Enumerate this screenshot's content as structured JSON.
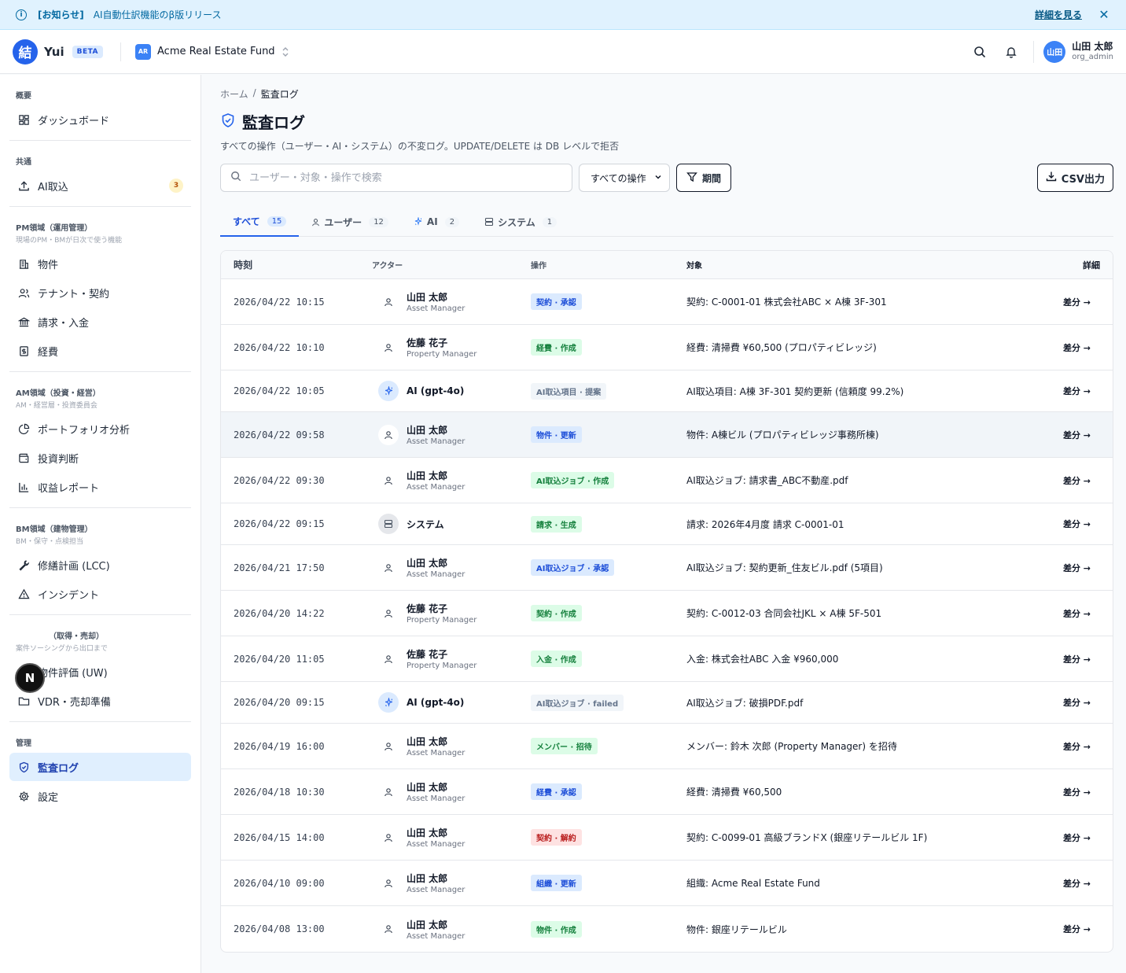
{
  "announcement": {
    "tag": "[お知らせ]",
    "text": "AI自動仕訳機能のβ版リリース",
    "link": "詳細を見る",
    "close": "✕"
  },
  "header": {
    "logo_char": "結",
    "brand": "Yui",
    "beta": "BETA",
    "org_badge": "AR",
    "org_name": "Acme Real Estate Fund",
    "user_avatar": "山田",
    "user_name": "山田 太郎",
    "user_role": "org_admin"
  },
  "sidebar": {
    "sections": [
      {
        "title": "概要",
        "items": [
          {
            "label": "ダッシュボード",
            "icon": "dashboard-icon"
          }
        ]
      },
      {
        "title": "共通",
        "items": [
          {
            "label": "AI取込",
            "icon": "upload-icon",
            "count": "3"
          }
        ]
      },
      {
        "title": "PM領域（運用管理）",
        "sub": "現場のPM・BMが日次で使う機能",
        "items": [
          {
            "label": "物件",
            "icon": "building-icon"
          },
          {
            "label": "テナント・契約",
            "icon": "users-icon"
          },
          {
            "label": "請求・入金",
            "icon": "bank-icon"
          },
          {
            "label": "経費",
            "icon": "receipt-icon"
          }
        ]
      },
      {
        "title": "AM領域（投資・経営）",
        "sub": "AM・経営層・投資委員会",
        "items": [
          {
            "label": "ポートフォリオ分析",
            "icon": "pie-chart-icon"
          },
          {
            "label": "投資判断",
            "icon": "wallet-icon"
          },
          {
            "label": "収益レポート",
            "icon": "bar-chart-icon"
          }
        ]
      },
      {
        "title": "BM領域（建物管理）",
        "sub": "BM・保守・点検担当",
        "items": [
          {
            "label": "修繕計画 (LCC)",
            "icon": "wrench-icon"
          },
          {
            "label": "インシデント",
            "icon": "alert-triangle-icon"
          }
        ]
      },
      {
        "title": "（取得・売却）",
        "sub": "案件ソーシングから出口まで",
        "items": [
          {
            "label": "物件評価 (UW)",
            "icon": "file-search-icon"
          },
          {
            "label": "VDR・売却準備",
            "icon": "folder-icon"
          }
        ]
      },
      {
        "title": "管理",
        "items": [
          {
            "label": "監査ログ",
            "icon": "shield-check-icon",
            "active": true
          },
          {
            "label": "設定",
            "icon": "gear-icon"
          }
        ]
      }
    ],
    "bubble": "N"
  },
  "main": {
    "breadcrumb": {
      "home": "ホーム",
      "sep": "/",
      "current": "監査ログ"
    },
    "title": "監査ログ",
    "subtitle": "すべての操作（ユーザー・AI・システム）の不変ログ。UPDATE/DELETE は DB レベルで拒否",
    "search_placeholder": "ユーザー・対象・操作で検索",
    "filter_select": "すべての操作",
    "period_button": "期間",
    "csv_button": "CSV出力",
    "tabs": [
      {
        "label": "すべて",
        "count": "15",
        "active": true
      },
      {
        "label": "ユーザー",
        "count": "12",
        "icon": "user-icon"
      },
      {
        "label": "AI",
        "count": "2",
        "icon": "sparkle-icon"
      },
      {
        "label": "システム",
        "count": "1",
        "icon": "server-icon"
      }
    ],
    "columns": {
      "time": "時刻",
      "actor": "アクター",
      "op": "操作",
      "target": "対象",
      "detail": "詳細"
    },
    "rows": [
      {
        "time": "2026/04/22 10:15",
        "actor_type": "user",
        "actor": "山田 太郎",
        "role": "Asset Manager",
        "op": "契約 · 承認",
        "color": "blue",
        "target": "契約: C-0001-01 株式会社ABC × A棟 3F-301",
        "detail": "差分 →"
      },
      {
        "time": "2026/04/22 10:10",
        "actor_type": "user",
        "actor": "佐藤 花子",
        "role": "Property Manager",
        "op": "経費 · 作成",
        "color": "green",
        "target": "経費: 清掃費 ¥60,500 (プロパティビレッジ)",
        "detail": "差分 →"
      },
      {
        "time": "2026/04/22 10:05",
        "actor_type": "ai",
        "actor": "AI (gpt-4o)",
        "role": "",
        "op": "AI取込項目 · 提案",
        "color": "gray",
        "target": "AI取込項目: A棟 3F-301 契約更新 (信頼度 99.2%)",
        "detail": "差分 →"
      },
      {
        "time": "2026/04/22 09:58",
        "actor_type": "user",
        "actor": "山田 太郎",
        "role": "Asset Manager",
        "op": "物件 · 更新",
        "color": "blue",
        "target": "物件: A棟ビル (プロパティビレッジ事務所棟)",
        "detail": "差分 →",
        "highlight": true
      },
      {
        "time": "2026/04/22 09:30",
        "actor_type": "user",
        "actor": "山田 太郎",
        "role": "Asset Manager",
        "op": "AI取込ジョブ · 作成",
        "color": "green",
        "target": "AI取込ジョブ: 請求書_ABC不動産.pdf",
        "detail": "差分 →"
      },
      {
        "time": "2026/04/22 09:15",
        "actor_type": "system",
        "actor": "システム",
        "role": "",
        "op": "請求 · 生成",
        "color": "green",
        "target": "請求: 2026年4月度 請求 C-0001-01",
        "detail": "差分 →"
      },
      {
        "time": "2026/04/21 17:50",
        "actor_type": "user",
        "actor": "山田 太郎",
        "role": "Asset Manager",
        "op": "AI取込ジョブ · 承認",
        "color": "blue",
        "target": "AI取込ジョブ: 契約更新_住友ビル.pdf (5項目)",
        "detail": "差分 →"
      },
      {
        "time": "2026/04/20 14:22",
        "actor_type": "user",
        "actor": "佐藤 花子",
        "role": "Property Manager",
        "op": "契約 · 作成",
        "color": "green",
        "target": "契約: C-0012-03 合同会社JKL × A棟 5F-501",
        "detail": "差分 →"
      },
      {
        "time": "2026/04/20 11:05",
        "actor_type": "user",
        "actor": "佐藤 花子",
        "role": "Property Manager",
        "op": "入金 · 作成",
        "color": "green",
        "target": "入金: 株式会社ABC 入金 ¥960,000",
        "detail": "差分 →"
      },
      {
        "time": "2026/04/20 09:15",
        "actor_type": "ai",
        "actor": "AI (gpt-4o)",
        "role": "",
        "op": "AI取込ジョブ · failed",
        "color": "gray",
        "target": "AI取込ジョブ: 破損PDF.pdf",
        "detail": "差分 →"
      },
      {
        "time": "2026/04/19 16:00",
        "actor_type": "user",
        "actor": "山田 太郎",
        "role": "Asset Manager",
        "op": "メンバー · 招待",
        "color": "green",
        "target": "メンバー: 鈴木 次郎 (Property Manager) を招待",
        "detail": "差分 →"
      },
      {
        "time": "2026/04/18 10:30",
        "actor_type": "user",
        "actor": "山田 太郎",
        "role": "Asset Manager",
        "op": "経費 · 承認",
        "color": "blue",
        "target": "経費: 清掃費 ¥60,500",
        "detail": "差分 →"
      },
      {
        "time": "2026/04/15 14:00",
        "actor_type": "user",
        "actor": "山田 太郎",
        "role": "Asset Manager",
        "op": "契約 · 解約",
        "color": "red",
        "target": "契約: C-0099-01 高級ブランドX (銀座リテールビル 1F)",
        "detail": "差分 →"
      },
      {
        "time": "2026/04/10 09:00",
        "actor_type": "user",
        "actor": "山田 太郎",
        "role": "Asset Manager",
        "op": "組織 · 更新",
        "color": "blue",
        "target": "組織: Acme Real Estate Fund",
        "detail": "差分 →"
      },
      {
        "time": "2026/04/08 13:00",
        "actor_type": "user",
        "actor": "山田 太郎",
        "role": "Asset Manager",
        "op": "物件 · 作成",
        "color": "green",
        "target": "物件: 銀座リテールビル",
        "detail": "差分 →"
      }
    ]
  }
}
